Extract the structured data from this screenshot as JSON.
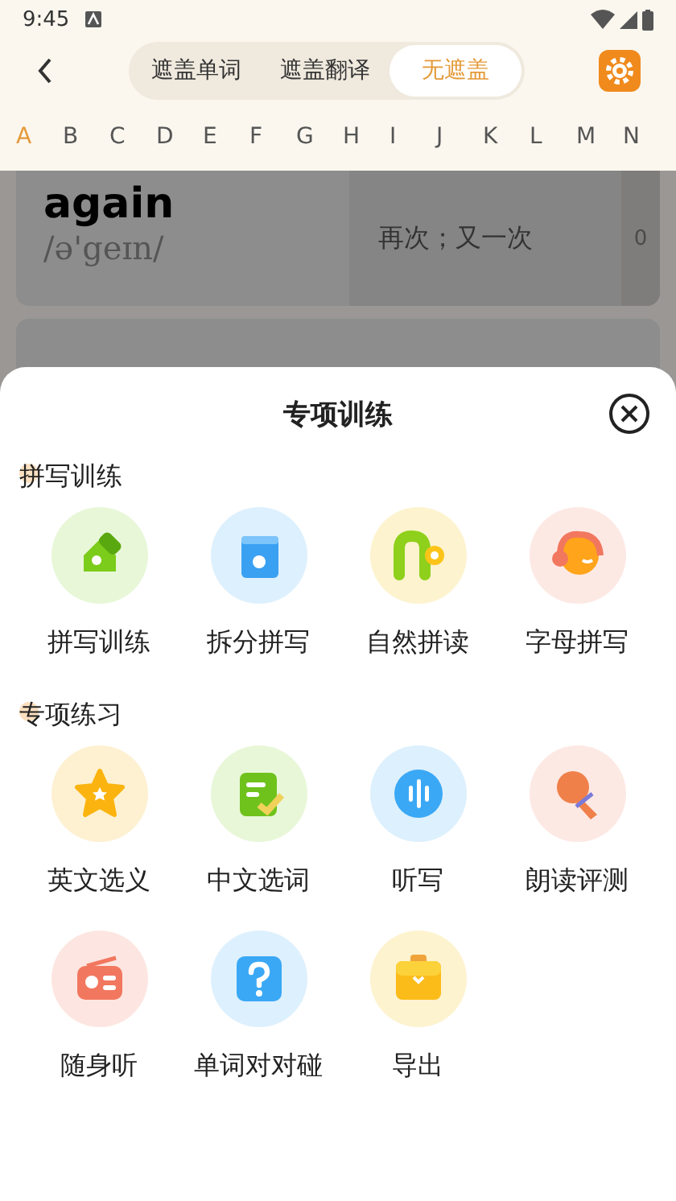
{
  "status_bar": {
    "time": "9:45"
  },
  "top_bar": {
    "tabs": [
      {
        "label": "遮盖单词",
        "selected": false
      },
      {
        "label": "遮盖翻译",
        "selected": false
      },
      {
        "label": "无遮盖",
        "selected": true
      }
    ]
  },
  "alphabet": [
    {
      "letter": "A",
      "selected": true
    },
    {
      "letter": "B",
      "selected": false
    },
    {
      "letter": "C",
      "selected": false
    },
    {
      "letter": "D",
      "selected": false
    },
    {
      "letter": "E",
      "selected": false
    },
    {
      "letter": "F",
      "selected": false
    },
    {
      "letter": "G",
      "selected": false
    },
    {
      "letter": "H",
      "selected": false
    },
    {
      "letter": "I",
      "selected": false
    },
    {
      "letter": "J",
      "selected": false
    },
    {
      "letter": "K",
      "selected": false
    },
    {
      "letter": "L",
      "selected": false
    },
    {
      "letter": "M",
      "selected": false
    },
    {
      "letter": "N",
      "selected": false
    }
  ],
  "word_list": [
    {
      "word": "again",
      "phonetic": "/ə'geɪn/",
      "translation": "再次；又一次",
      "count": "0"
    }
  ],
  "sheet": {
    "title": "专项训练",
    "sections": [
      {
        "title": "拼写训练",
        "items": [
          {
            "label": "拼写训练"
          },
          {
            "label": "拆分拼写"
          },
          {
            "label": "自然拼读"
          },
          {
            "label": "字母拼写"
          }
        ]
      },
      {
        "title": "专项练习",
        "items": [
          {
            "label": "英文选义"
          },
          {
            "label": "中文选词"
          },
          {
            "label": "听写"
          },
          {
            "label": "朗读评测"
          },
          {
            "label": "随身听"
          },
          {
            "label": "单词对对碰"
          },
          {
            "label": "导出"
          }
        ]
      }
    ]
  }
}
